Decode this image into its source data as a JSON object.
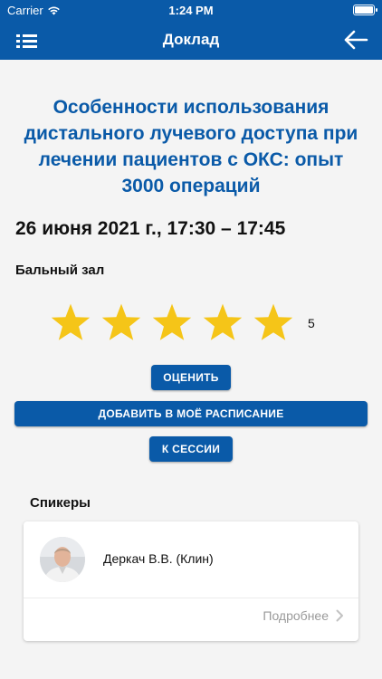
{
  "status_bar": {
    "carrier": "Carrier",
    "time": "1:24 PM",
    "battery_level": 1.0
  },
  "nav": {
    "title": "Доклад",
    "menu_icon": "menu-list-icon",
    "back_icon": "arrow-left-icon"
  },
  "talk": {
    "title": "Особенности использования дистального лучевого доступа при лечении пациентов с ОКС: опыт 3000 операций",
    "date": "26 июня 2021 г., 17:30 – 17:45",
    "room": "Бальный зал"
  },
  "rating": {
    "stars": 5,
    "max": 5,
    "value_text": "5",
    "star_color": "#f5c518"
  },
  "buttons": {
    "rate": "ОЦЕНИТЬ",
    "add_schedule": "ДОБАВИТЬ В МОЁ РАСПИСАНИЕ",
    "to_session": "К СЕССИИ"
  },
  "speakers": {
    "title": "Спикеры",
    "items": [
      {
        "name": "Деркач В.В. (Клин)",
        "more": "Подробнее"
      }
    ]
  },
  "colors": {
    "primary": "#0a5aa8",
    "background": "#f4f4f4"
  }
}
